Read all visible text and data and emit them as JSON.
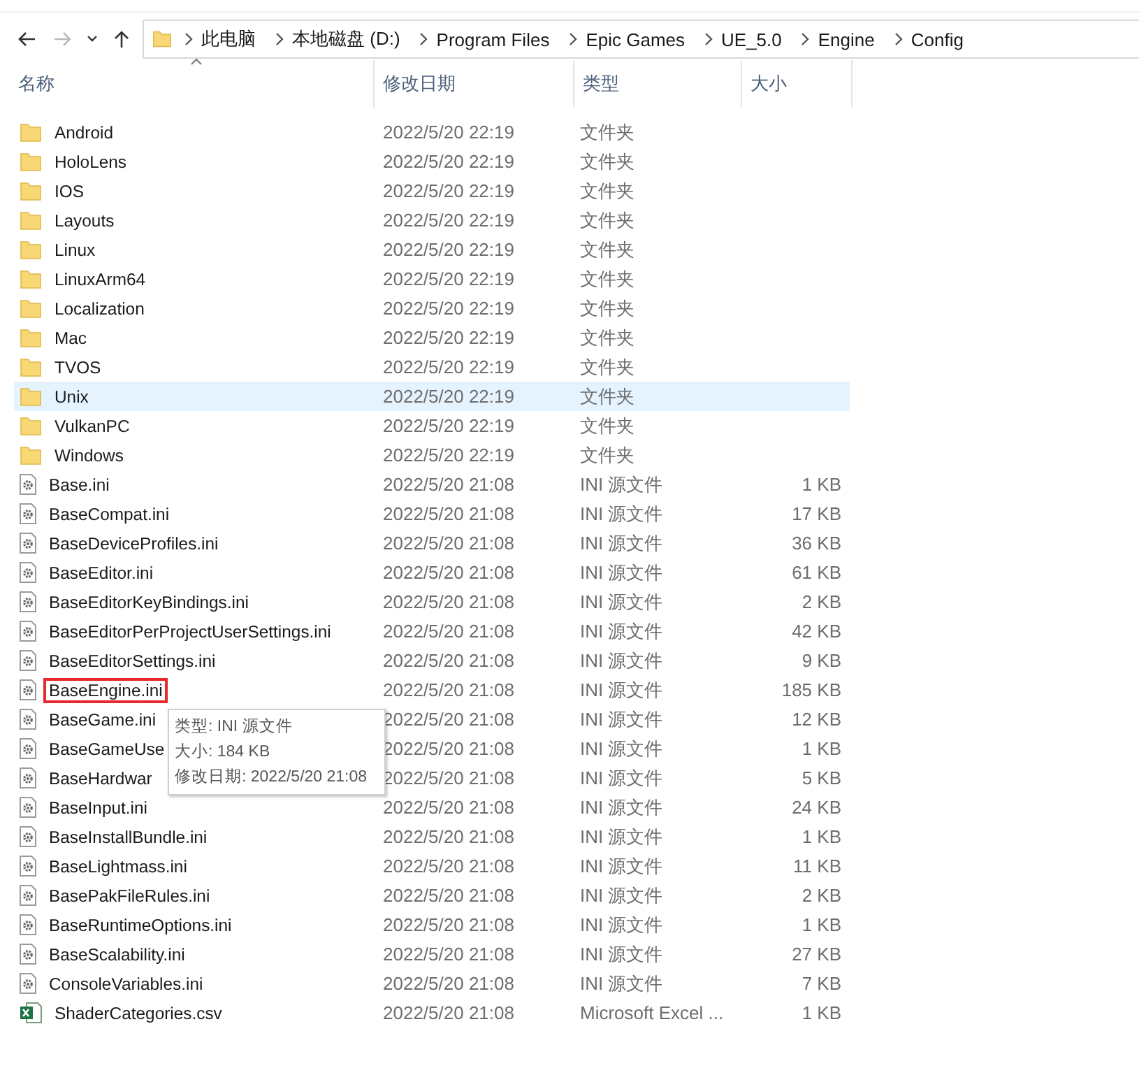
{
  "nav": {
    "back_enabled": true,
    "forward_enabled": false
  },
  "breadcrumbs": [
    "此电脑",
    "本地磁盘 (D:)",
    "Program Files",
    "Epic Games",
    "UE_5.0",
    "Engine",
    "Config"
  ],
  "columns": [
    {
      "label": "名称",
      "sorted": true
    },
    {
      "label": "修改日期",
      "sorted": false
    },
    {
      "label": "类型",
      "sorted": false
    },
    {
      "label": "大小",
      "sorted": false
    }
  ],
  "rows": [
    {
      "kind": "folder",
      "name": "Android",
      "date": "2022/5/20 22:19",
      "type": "文件夹",
      "hovered": false,
      "boxed": false
    },
    {
      "kind": "folder",
      "name": "HoloLens",
      "date": "2022/5/20 22:19",
      "type": "文件夹",
      "hovered": false,
      "boxed": false
    },
    {
      "kind": "folder",
      "name": "IOS",
      "date": "2022/5/20 22:19",
      "type": "文件夹",
      "hovered": false,
      "boxed": false
    },
    {
      "kind": "folder",
      "name": "Layouts",
      "date": "2022/5/20 22:19",
      "type": "文件夹",
      "hovered": false,
      "boxed": false
    },
    {
      "kind": "folder",
      "name": "Linux",
      "date": "2022/5/20 22:19",
      "type": "文件夹",
      "hovered": false,
      "boxed": false
    },
    {
      "kind": "folder",
      "name": "LinuxArm64",
      "date": "2022/5/20 22:19",
      "type": "文件夹",
      "hovered": false,
      "boxed": false
    },
    {
      "kind": "folder",
      "name": "Localization",
      "date": "2022/5/20 22:19",
      "type": "文件夹",
      "hovered": false,
      "boxed": false
    },
    {
      "kind": "folder",
      "name": "Mac",
      "date": "2022/5/20 22:19",
      "type": "文件夹",
      "hovered": false,
      "boxed": false
    },
    {
      "kind": "folder",
      "name": "TVOS",
      "date": "2022/5/20 22:19",
      "type": "文件夹",
      "hovered": false,
      "boxed": false
    },
    {
      "kind": "folder",
      "name": "Unix",
      "date": "2022/5/20 22:19",
      "type": "文件夹",
      "hovered": true,
      "boxed": false
    },
    {
      "kind": "folder",
      "name": "VulkanPC",
      "date": "2022/5/20 22:19",
      "type": "文件夹",
      "hovered": false,
      "boxed": false
    },
    {
      "kind": "folder",
      "name": "Windows",
      "date": "2022/5/20 22:19",
      "type": "文件夹",
      "hovered": false,
      "boxed": false
    },
    {
      "kind": "ini",
      "name": "Base.ini",
      "date": "2022/5/20 21:08",
      "type": "INI 源文件",
      "size": "1 KB",
      "hovered": false,
      "boxed": false
    },
    {
      "kind": "ini",
      "name": "BaseCompat.ini",
      "date": "2022/5/20 21:08",
      "type": "INI 源文件",
      "size": "17 KB",
      "hovered": false,
      "boxed": false
    },
    {
      "kind": "ini",
      "name": "BaseDeviceProfiles.ini",
      "date": "2022/5/20 21:08",
      "type": "INI 源文件",
      "size": "36 KB",
      "hovered": false,
      "boxed": false
    },
    {
      "kind": "ini",
      "name": "BaseEditor.ini",
      "date": "2022/5/20 21:08",
      "type": "INI 源文件",
      "size": "61 KB",
      "hovered": false,
      "boxed": false
    },
    {
      "kind": "ini",
      "name": "BaseEditorKeyBindings.ini",
      "date": "2022/5/20 21:08",
      "type": "INI 源文件",
      "size": "2 KB",
      "hovered": false,
      "boxed": false
    },
    {
      "kind": "ini",
      "name": "BaseEditorPerProjectUserSettings.ini",
      "date": "2022/5/20 21:08",
      "type": "INI 源文件",
      "size": "42 KB",
      "hovered": false,
      "boxed": false
    },
    {
      "kind": "ini",
      "name": "BaseEditorSettings.ini",
      "date": "2022/5/20 21:08",
      "type": "INI 源文件",
      "size": "9 KB",
      "hovered": false,
      "boxed": false
    },
    {
      "kind": "ini",
      "name": "BaseEngine.ini",
      "date": "2022/5/20 21:08",
      "type": "INI 源文件",
      "size": "185 KB",
      "hovered": false,
      "boxed": true
    },
    {
      "kind": "ini",
      "name": "BaseGame.ini",
      "date": "2022/5/20 21:08",
      "type": "INI 源文件",
      "size": "12 KB",
      "hovered": false,
      "boxed": false
    },
    {
      "kind": "ini",
      "name": "BaseGameUse",
      "date": "2022/5/20 21:08",
      "type": "INI 源文件",
      "size": "1 KB",
      "hovered": false,
      "boxed": false
    },
    {
      "kind": "ini",
      "name": "BaseHardwar",
      "date": "2022/5/20 21:08",
      "type": "INI 源文件",
      "size": "5 KB",
      "hovered": false,
      "boxed": false
    },
    {
      "kind": "ini",
      "name": "BaseInput.ini",
      "date": "2022/5/20 21:08",
      "type": "INI 源文件",
      "size": "24 KB",
      "hovered": false,
      "boxed": false
    },
    {
      "kind": "ini",
      "name": "BaseInstallBundle.ini",
      "date": "2022/5/20 21:08",
      "type": "INI 源文件",
      "size": "1 KB",
      "hovered": false,
      "boxed": false
    },
    {
      "kind": "ini",
      "name": "BaseLightmass.ini",
      "date": "2022/5/20 21:08",
      "type": "INI 源文件",
      "size": "11 KB",
      "hovered": false,
      "boxed": false
    },
    {
      "kind": "ini",
      "name": "BasePakFileRules.ini",
      "date": "2022/5/20 21:08",
      "type": "INI 源文件",
      "size": "2 KB",
      "hovered": false,
      "boxed": false
    },
    {
      "kind": "ini",
      "name": "BaseRuntimeOptions.ini",
      "date": "2022/5/20 21:08",
      "type": "INI 源文件",
      "size": "1 KB",
      "hovered": false,
      "boxed": false
    },
    {
      "kind": "ini",
      "name": "BaseScalability.ini",
      "date": "2022/5/20 21:08",
      "type": "INI 源文件",
      "size": "27 KB",
      "hovered": false,
      "boxed": false
    },
    {
      "kind": "ini",
      "name": "ConsoleVariables.ini",
      "date": "2022/5/20 21:08",
      "type": "INI 源文件",
      "size": "7 KB",
      "hovered": false,
      "boxed": false
    },
    {
      "kind": "csv",
      "name": "ShaderCategories.csv",
      "date": "2022/5/20 21:08",
      "type": "Microsoft Excel ...",
      "size": "1 KB",
      "hovered": false,
      "boxed": false
    }
  ],
  "tooltip": [
    "类型: INI 源文件",
    "大小: 184 KB",
    "修改日期: 2022/5/20 21:08"
  ]
}
